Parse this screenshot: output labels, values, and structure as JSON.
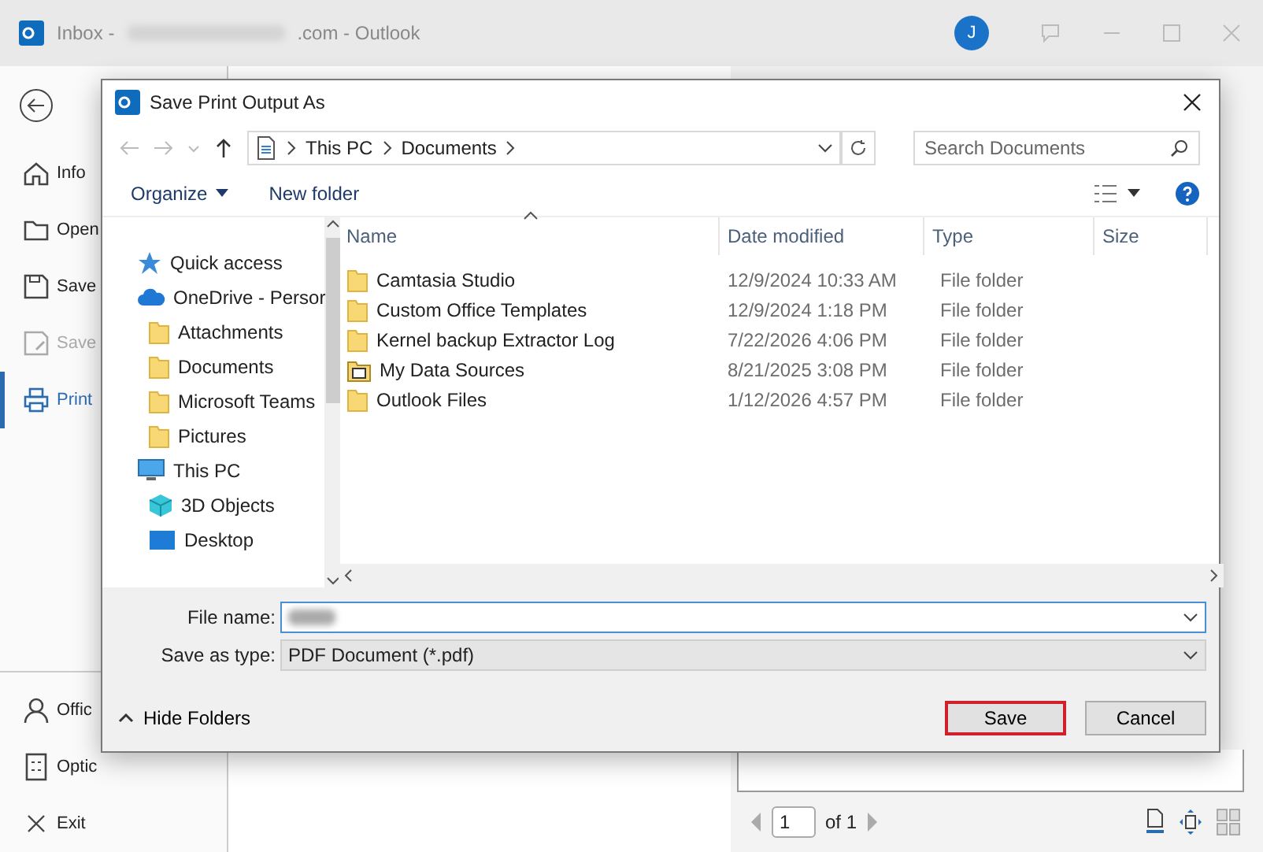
{
  "window": {
    "title_prefix": "Inbox -",
    "title_suffix": ".com - Outlook",
    "avatar": "J"
  },
  "backstage": {
    "items": [
      {
        "label": "Info",
        "selected": false,
        "disabled": false
      },
      {
        "label": "Open",
        "selected": false,
        "disabled": false
      },
      {
        "label": "Save",
        "selected": false,
        "disabled": false
      },
      {
        "label": "Save",
        "selected": false,
        "disabled": true
      },
      {
        "label": "Print",
        "selected": true,
        "disabled": false
      }
    ],
    "bottom_items": [
      {
        "label": "Offic"
      },
      {
        "label": "Optic"
      },
      {
        "label": "Exit"
      }
    ]
  },
  "preview": {
    "page_field": "1",
    "page_count": "of 1"
  },
  "dialog": {
    "title": "Save Print Output As",
    "path": [
      "This PC",
      "Documents"
    ],
    "search": {
      "placeholder": "Search Documents"
    },
    "organize": "Organize",
    "new_folder": "New folder",
    "tree": [
      {
        "kind": "star",
        "label": "Quick access"
      },
      {
        "kind": "cloud",
        "label": "OneDrive - Persor",
        "children": [
          {
            "kind": "folder",
            "label": "Attachments"
          },
          {
            "kind": "folder",
            "label": "Documents"
          },
          {
            "kind": "folder",
            "label": "Microsoft Teams"
          },
          {
            "kind": "folder",
            "label": "Pictures"
          }
        ]
      },
      {
        "kind": "computer",
        "label": "This PC",
        "children": [
          {
            "kind": "cube",
            "label": "3D Objects"
          },
          {
            "kind": "desktop",
            "label": "Desktop"
          }
        ]
      }
    ],
    "columns": [
      "Name",
      "Date modified",
      "Type",
      "Size"
    ],
    "files": [
      {
        "kind": "folder",
        "name": "Camtasia Studio",
        "date": "12/9/2024 10:33 AM",
        "type": "File folder"
      },
      {
        "kind": "folder",
        "name": "Custom Office Templates",
        "date": "12/9/2024 1:18 PM",
        "type": "File folder"
      },
      {
        "kind": "folder",
        "name": "Kernel backup Extractor Log",
        "date": "7/22/2026 4:06 PM",
        "type": "File folder"
      },
      {
        "kind": "special",
        "name": "My Data Sources",
        "date": "8/21/2025 3:08 PM",
        "type": "File folder"
      },
      {
        "kind": "folder",
        "name": "Outlook Files",
        "date": "1/12/2026 4:57 PM",
        "type": "File folder"
      }
    ],
    "file_name_label": "File name:",
    "save_type_label": "Save as type:",
    "save_type": "PDF Document (*.pdf)",
    "hide_folders": "Hide Folders",
    "buttons": [
      {
        "label": "Save",
        "highlighted": true
      },
      {
        "label": "Cancel",
        "highlighted": false
      }
    ]
  }
}
